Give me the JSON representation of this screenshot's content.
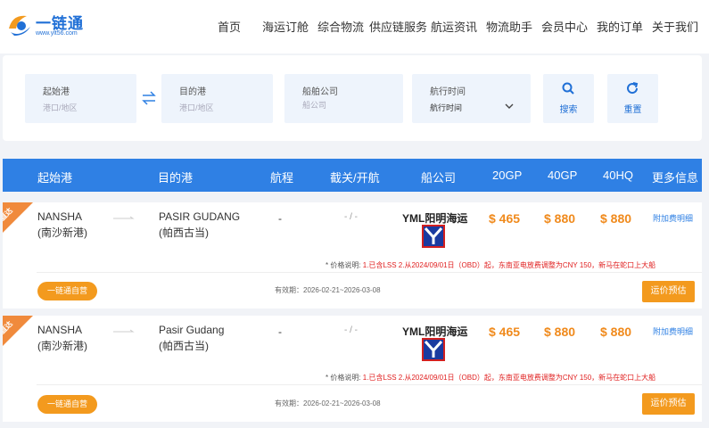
{
  "header": {
    "logo_text": "一链通",
    "logo_url": "www.ylt56.com",
    "nav": [
      "首页",
      "海运订舱",
      "综合物流",
      "供应链服务",
      "航运资讯",
      "物流助手",
      "会员中心",
      "我的订单",
      "关于我们"
    ]
  },
  "search": {
    "origin": {
      "label": "起始港",
      "placeholder": "港口/地区"
    },
    "destination": {
      "label": "目的港",
      "placeholder": "港口/地区"
    },
    "carrier": {
      "label": "船舶公司",
      "placeholder": "船公司"
    },
    "sail_time": {
      "label": "航行时间",
      "value": "航行时间"
    },
    "search_button": "搜索",
    "reset_button": "重置"
  },
  "table": {
    "headers": [
      "起始港",
      "目的港",
      "航程",
      "截关/开航",
      "船公司",
      "20GP",
      "40GP",
      "40HQ",
      "更多信息"
    ]
  },
  "rows": [
    {
      "ribbon": "直达",
      "origin_en": "NANSHA",
      "origin_cn": "(南沙新港)",
      "dest_en": "PASIR GUDANG",
      "dest_cn": "(帕西古当)",
      "voyage": "-",
      "cutoff": "- / -",
      "carrier": "YML阳明海运",
      "p20gp": "$ 465",
      "p40gp": "$ 880",
      "p40hq": "$ 880",
      "more": "附加费明细",
      "note_label": "* 价格说明:",
      "note_text": "1.已含LSS 2.从2024/09/01日（OBD）起，东南亚电放费调整为CNY 150，新马在蛇口上大船",
      "badge": "一链通自营",
      "validity": "有效期：2026-02-21~2026-03-08",
      "quote": "运价预估"
    },
    {
      "ribbon": "直达",
      "origin_en": "NANSHA",
      "origin_cn": "(南沙新港)",
      "dest_en": "Pasir Gudang",
      "dest_cn": "(帕西古当)",
      "voyage": "-",
      "cutoff": "- / -",
      "carrier": "YML阳明海运",
      "p20gp": "$ 465",
      "p40gp": "$ 880",
      "p40hq": "$ 880",
      "more": "附加费明细",
      "note_label": "* 价格说明:",
      "note_text": "1.已含LSS 2.从2024/09/01日（OBD）起，东南亚电放费调整为CNY 150，新马在蛇口上大船",
      "badge": "一链通自营",
      "validity": "有效期：2026-02-21~2026-03-08",
      "quote": "运价预估"
    }
  ],
  "colors": {
    "primary": "#2f80e4",
    "accent": "#f39a1e",
    "price": "#f08a1c",
    "note": "#e02020"
  }
}
